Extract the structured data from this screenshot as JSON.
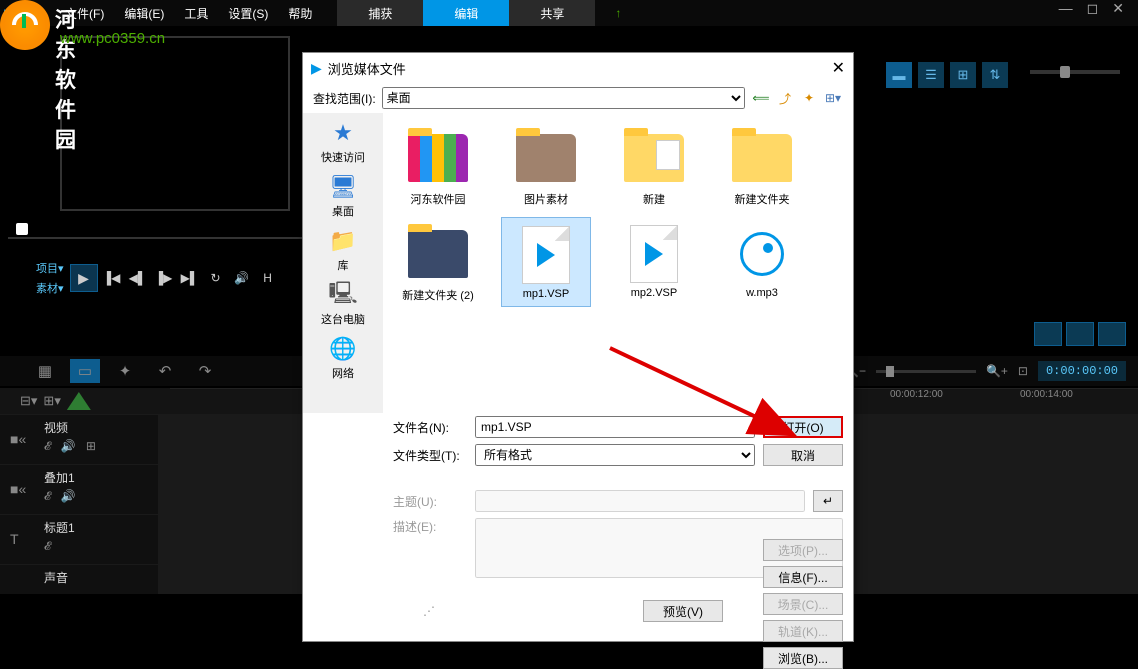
{
  "menubar": {
    "file": "文件(F)",
    "edit": "编辑(E)",
    "tools": "工具",
    "settings": "设置(S)",
    "help": "帮助",
    "tab_capture": "捕获",
    "tab_edit": "编辑",
    "tab_share": "共享"
  },
  "watermark": {
    "title": "河东软件园",
    "url": "www.pc0359.cn"
  },
  "transport": {
    "label_project": "项目▾",
    "label_clip": "素材▾"
  },
  "timeline": {
    "timecode": "0:00:00:00",
    "ruler_12": "00:00:12:00",
    "ruler_14": "00:00:14:00"
  },
  "tracks": {
    "video": "视频",
    "overlay": "叠加1",
    "title": "标题1",
    "audio": "声音"
  },
  "dialog": {
    "title": "浏览媒体文件",
    "lookin_label": "查找范围(I):",
    "lookin_value": "桌面",
    "places": {
      "quick": "快速访问",
      "desktop": "桌面",
      "library": "库",
      "thispc": "这台电脑",
      "network": "网络"
    },
    "files": [
      {
        "name": "河东软件园",
        "type": "folder-color"
      },
      {
        "name": "图片素材",
        "type": "folder-img"
      },
      {
        "name": "新建",
        "type": "folder-doc"
      },
      {
        "name": "新建文件夹",
        "type": "folder"
      },
      {
        "name": "新建文件夹 (2)",
        "type": "folder-multi"
      },
      {
        "name": "mp1.VSP",
        "type": "vsp",
        "selected": true
      },
      {
        "name": "mp2.VSP",
        "type": "vsp"
      },
      {
        "name": "w.mp3",
        "type": "audio"
      }
    ],
    "filename_label": "文件名(N):",
    "filename_value": "mp1.VSP",
    "filetype_label": "文件类型(T):",
    "filetype_value": "所有格式",
    "subject_label": "主题(U):",
    "desc_label": "描述(E):",
    "btn_open": "打开(O)",
    "btn_cancel": "取消",
    "btn_options": "选项(P)...",
    "btn_info": "信息(F)...",
    "btn_scene": "场景(C)...",
    "btn_track": "轨道(K)...",
    "btn_browse": "浏览(B)...",
    "btn_preview": "预览(V)"
  }
}
